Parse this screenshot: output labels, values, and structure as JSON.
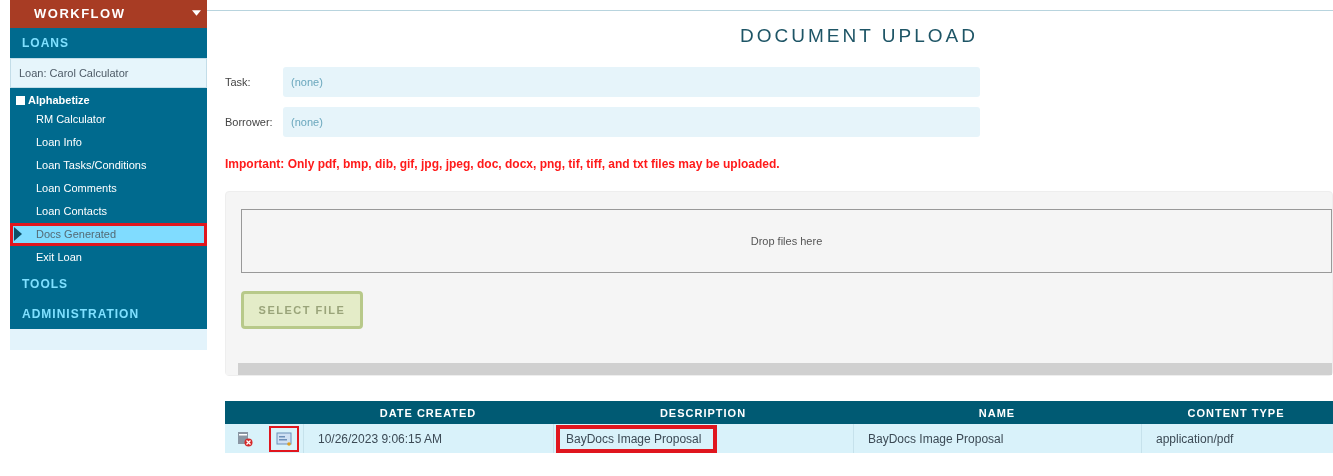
{
  "sidebar": {
    "workflow": "WORKFLOW",
    "sections": [
      {
        "label": "LOANS",
        "loan": "Loan: Carol Calculator",
        "alphabetize": {
          "label": "Alphabetize",
          "checked": false
        },
        "items": [
          {
            "label": "RM Calculator",
            "selected": false,
            "annotated": false
          },
          {
            "label": "Loan Info",
            "selected": false,
            "annotated": false
          },
          {
            "label": "Loan Tasks/Conditions",
            "selected": false,
            "annotated": false
          },
          {
            "label": "Loan Comments",
            "selected": false,
            "annotated": false
          },
          {
            "label": "Loan Contacts",
            "selected": false,
            "annotated": false
          },
          {
            "label": "Docs Generated",
            "selected": true,
            "annotated": true
          },
          {
            "label": "Exit Loan",
            "selected": false,
            "annotated": false
          }
        ]
      },
      {
        "label": "TOOLS"
      },
      {
        "label": "ADMINISTRATION"
      }
    ]
  },
  "page": {
    "title": "DOCUMENT UPLOAD",
    "fields": [
      {
        "label": "Task:",
        "placeholder": "(none)"
      },
      {
        "label": "Borrower:",
        "placeholder": "(none)"
      }
    ],
    "notice": "Important: Only pdf, bmp, dib, gif, jpg, jpeg, doc, docx, png, tif, tiff, and txt files may be uploaded.",
    "dropzone": "Drop files here",
    "select_button": "SELECT FILE"
  },
  "table": {
    "columns": [
      "DATE CREATED",
      "DESCRIPTION",
      "NAME",
      "CONTENT TYPE"
    ],
    "rows": [
      {
        "date": "10/26/2023 9:06:15 AM",
        "description": "BayDocs Image Proposal",
        "name": "BayDocs Image Proposal",
        "content_type": "application/pdf",
        "view_annotated": true,
        "description_annotated": true
      }
    ]
  }
}
